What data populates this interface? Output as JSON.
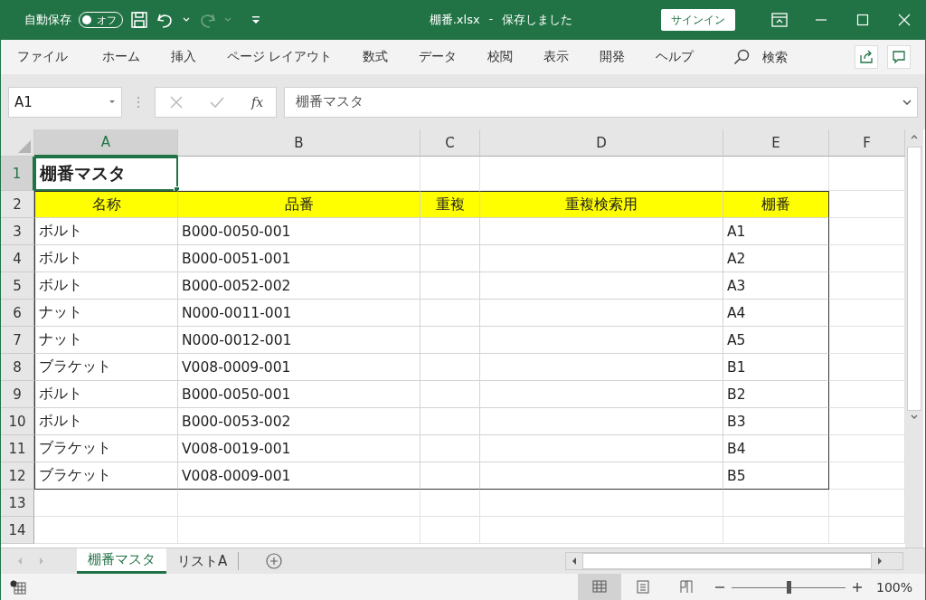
{
  "title_bar": {
    "autosave_label": "自動保存",
    "autosave_toggle": {
      "label": "オフ",
      "on": false
    },
    "file_name": "棚番.xlsx",
    "separator": "-",
    "save_status": "保存しました",
    "sign_in": "サインイン",
    "redo_disabled": true
  },
  "ribbon_tabs": [
    {
      "label": "ファイル"
    },
    {
      "label": "ホーム"
    },
    {
      "label": "挿入"
    },
    {
      "label": "ページ レイアウト"
    },
    {
      "label": "数式"
    },
    {
      "label": "データ"
    },
    {
      "label": "校閲"
    },
    {
      "label": "表示"
    },
    {
      "label": "開発"
    },
    {
      "label": "ヘルプ"
    }
  ],
  "search": {
    "placeholder": "検索"
  },
  "formula_bar": {
    "name_box": "A1",
    "formula": "棚番マスタ",
    "fx": "fx"
  },
  "columns": [
    {
      "label": "A",
      "selected": true
    },
    {
      "label": "B",
      "selected": false
    },
    {
      "label": "C",
      "selected": false
    },
    {
      "label": "D",
      "selected": false
    },
    {
      "label": "E",
      "selected": false
    },
    {
      "label": "F",
      "selected": false
    }
  ],
  "rows": [
    {
      "number": "1",
      "kind": "title",
      "selected": true,
      "cells": {
        "A": "棚番マスタ"
      }
    },
    {
      "number": "2",
      "kind": "header",
      "selected": false,
      "cells": {
        "A": "名称",
        "B": "品番",
        "C": "重複",
        "D": "重複検索用",
        "E": "棚番"
      }
    },
    {
      "number": "3",
      "kind": "data",
      "selected": false,
      "cells": {
        "A": "ボルト",
        "B": "B000-0050-001",
        "E": "A1"
      }
    },
    {
      "number": "4",
      "kind": "data",
      "selected": false,
      "cells": {
        "A": "ボルト",
        "B": "B000-0051-001",
        "E": "A2"
      }
    },
    {
      "number": "5",
      "kind": "data",
      "selected": false,
      "cells": {
        "A": "ボルト",
        "B": "B000-0052-002",
        "E": "A3"
      }
    },
    {
      "number": "6",
      "kind": "data",
      "selected": false,
      "cells": {
        "A": "ナット",
        "B": "N000-0011-001",
        "E": "A4"
      }
    },
    {
      "number": "7",
      "kind": "data",
      "selected": false,
      "cells": {
        "A": "ナット",
        "B": "N000-0012-001",
        "E": "A5"
      }
    },
    {
      "number": "8",
      "kind": "data",
      "selected": false,
      "cells": {
        "A": "ブラケット",
        "B": "V008-0009-001",
        "E": "B1"
      }
    },
    {
      "number": "9",
      "kind": "data",
      "selected": false,
      "cells": {
        "A": "ボルト",
        "B": "B000-0050-001",
        "E": "B2"
      }
    },
    {
      "number": "10",
      "kind": "data",
      "selected": false,
      "cells": {
        "A": "ボルト",
        "B": "B000-0053-002",
        "E": "B3"
      }
    },
    {
      "number": "11",
      "kind": "data",
      "selected": false,
      "cells": {
        "A": "ブラケット",
        "B": "V008-0019-001",
        "E": "B4"
      }
    },
    {
      "number": "12",
      "kind": "data",
      "selected": false,
      "cells": {
        "A": "ブラケット",
        "B": "V008-0009-001",
        "E": "B5"
      }
    },
    {
      "number": "13",
      "kind": "blank",
      "selected": false,
      "cells": {}
    },
    {
      "number": "14",
      "kind": "blank",
      "selected": false,
      "cells": {}
    }
  ],
  "sheet_tabs": [
    {
      "label": "棚番マスタ",
      "selected": true
    },
    {
      "label": "リストA",
      "selected": false
    }
  ],
  "status_bar": {
    "views": [
      {
        "kind": "normal",
        "selected": true
      },
      {
        "kind": "page-layout",
        "selected": false
      },
      {
        "kind": "page-break",
        "selected": false
      }
    ],
    "zoom_slider": {
      "level": 0.5
    },
    "zoom": "100%"
  }
}
